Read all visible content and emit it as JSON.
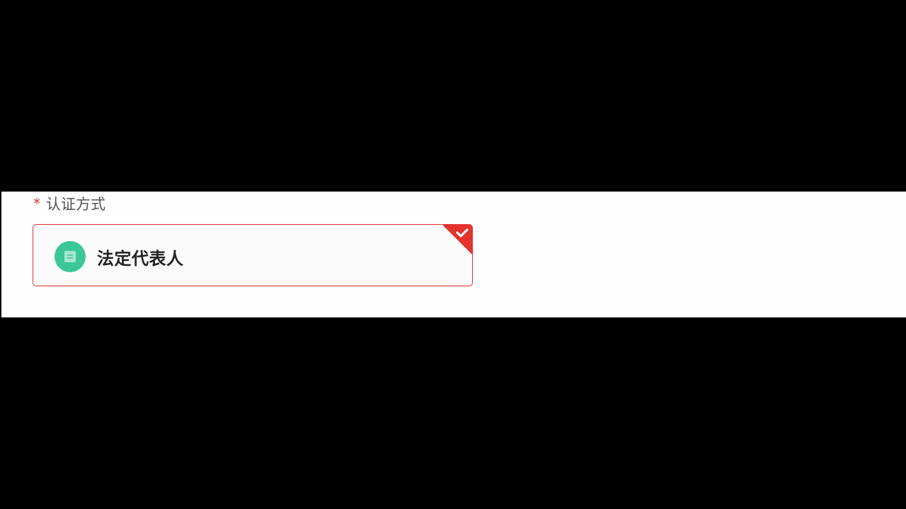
{
  "form": {
    "required_mark": "*",
    "auth_method_label": "认证方式",
    "options": [
      {
        "label": "法定代表人",
        "icon": "document-icon",
        "selected": true,
        "icon_color": "#3cc799"
      }
    ]
  },
  "colors": {
    "accent": "#e5322d",
    "icon_green": "#3cc799",
    "panel_bg": "#fefefe",
    "backdrop": "#000000"
  }
}
